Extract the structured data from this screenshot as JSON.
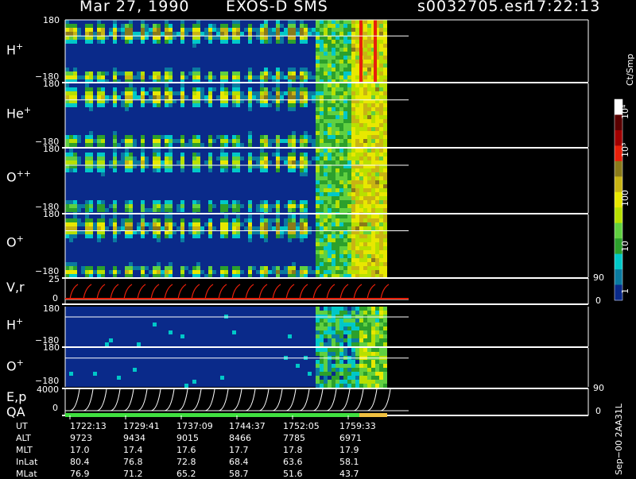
{
  "header": {
    "date": "Mar 27, 1990",
    "instrument": "EXOS-D SMS",
    "file": "s0032705.esr",
    "time": "17:22:13"
  },
  "panels": [
    {
      "id": "h1",
      "label": "H",
      "sup": "+",
      "top_tick": "180",
      "bot_tick": "−180"
    },
    {
      "id": "he",
      "label": "He",
      "sup": "+",
      "top_tick": "180",
      "bot_tick": "−180"
    },
    {
      "id": "opp",
      "label": "O",
      "sup": "++",
      "top_tick": "180",
      "bot_tick": "−180"
    },
    {
      "id": "o1",
      "label": "O",
      "sup": "+",
      "top_tick": "180",
      "bot_tick": "−180"
    },
    {
      "id": "vr",
      "label": "V,r",
      "sup": "",
      "top_tick": "25",
      "bot_tick": "0",
      "right_top": "90",
      "right_bot": "0"
    },
    {
      "id": "h2",
      "label": "H",
      "sup": "+",
      "top_tick": "180",
      "bot_tick": "−180"
    },
    {
      "id": "o2",
      "label": "O",
      "sup": "+",
      "top_tick": "180",
      "bot_tick": "−180"
    },
    {
      "id": "ep",
      "label": "E,p",
      "label2": "QA",
      "sup": "",
      "top_tick": "4000",
      "bot_tick": "0",
      "right_top": "90",
      "right_bot": "0"
    }
  ],
  "colorbar": {
    "title": "Ct/Smp",
    "ticks": [
      "10⁴",
      "10³",
      "100",
      "10",
      "1"
    ],
    "colors": [
      "#ffffff",
      "#5a0000",
      "#a00000",
      "#e8200a",
      "#8a7a1a",
      "#c8b414",
      "#e8e800",
      "#b8e000",
      "#60d040",
      "#2ca02c",
      "#00c8c8",
      "#0a7aa0",
      "#0a2a8a"
    ]
  },
  "table": {
    "row_labels": [
      "UT",
      "ALT",
      "MLT",
      "InLat",
      "MLat"
    ],
    "columns": [
      [
        "1722:13",
        "9723",
        "17.0",
        "80.4",
        "76.9"
      ],
      [
        "1729:41",
        "9434",
        "17.4",
        "76.8",
        "71.2"
      ],
      [
        "1737:09",
        "9015",
        "17.6",
        "72.8",
        "65.2"
      ],
      [
        "1744:37",
        "8466",
        "17.7",
        "68.4",
        "58.7"
      ],
      [
        "1752:05",
        "7785",
        "17.8",
        "63.6",
        "51.6"
      ],
      [
        "1759:33",
        "6971",
        "17.9",
        "58.1",
        "43.7"
      ]
    ]
  },
  "footer": "Sep−00  2AA31L",
  "chart_data": {
    "type": "heatmap",
    "title": "Mar 27, 1990   EXOS-D SMS",
    "x_label": "UT",
    "x_ticks": [
      "1722:13",
      "1729:41",
      "1737:09",
      "1744:37",
      "1752:05",
      "1759:33"
    ],
    "panels": [
      "H+",
      "He+",
      "O++",
      "O+",
      "V,r",
      "H+",
      "O+",
      "E,p / QA"
    ],
    "colorbar_units": "Ct/Smp",
    "colorbar_ticks": [
      "1",
      "10",
      "100",
      "10^3",
      "10^4"
    ]
  }
}
